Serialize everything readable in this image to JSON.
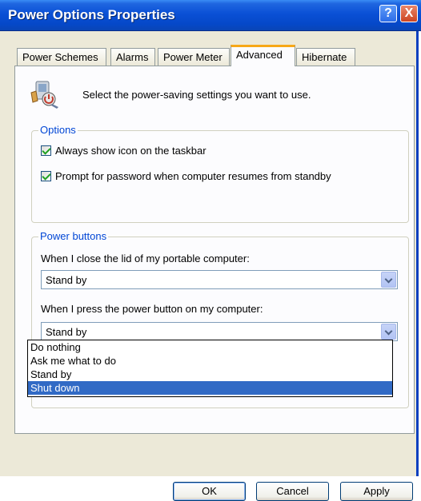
{
  "window": {
    "title": "Power Options Properties"
  },
  "titlebar": {
    "help_glyph": "?",
    "close_glyph": "X"
  },
  "tabs": [
    {
      "label": "Power Schemes"
    },
    {
      "label": "Alarms"
    },
    {
      "label": "Power Meter"
    },
    {
      "label": "Advanced",
      "active": true
    },
    {
      "label": "Hibernate"
    }
  ],
  "intro": {
    "text": "Select the power-saving settings you want to use.",
    "icon": "power-settings-icon"
  },
  "options": {
    "title": "Options",
    "always_show_icon": {
      "label": "Always show icon on the taskbar",
      "checked": true
    },
    "prompt_password": {
      "label": "Prompt for password when computer resumes from standby",
      "checked": true
    }
  },
  "power_buttons": {
    "title": "Power buttons",
    "lid_label": "When I close the lid of my portable computer:",
    "lid_value": "Stand by",
    "power_label": "When I press the power button on my computer:",
    "power_value": "Stand by",
    "power_options": [
      "Do nothing",
      "Ask me what to do",
      "Stand by",
      "Shut down"
    ],
    "highlighted_option": "Shut down"
  },
  "buttons": {
    "ok": "OK",
    "cancel": "Cancel",
    "apply": "Apply"
  },
  "colors": {
    "titlebar": "#0a50d6",
    "group_title": "#0046d5",
    "selection": "#316ac5",
    "active_tab_accent": "#f7a818"
  }
}
